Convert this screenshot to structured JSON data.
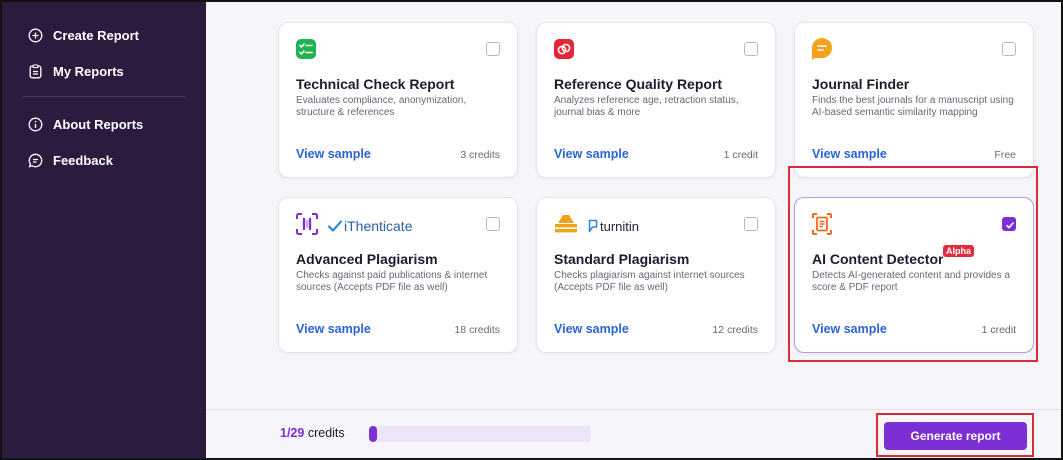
{
  "sidebar": {
    "items": [
      {
        "label": "Create Report",
        "icon": "plus-circle-icon"
      },
      {
        "label": "My Reports",
        "icon": "clipboard-icon"
      },
      {
        "label": "About Reports",
        "icon": "info-circle-icon"
      },
      {
        "label": "Feedback",
        "icon": "message-square-icon"
      }
    ]
  },
  "cards": [
    {
      "title": "Technical Check Report",
      "desc": "Evaluates compliance, anonymization, structure & references",
      "sample": "View sample",
      "credits": "3 credits",
      "checked": false,
      "icon": "checklist-icon",
      "icon_color": "#1eb253"
    },
    {
      "title": "Reference Quality Report",
      "desc": "Analyzes reference age, retraction status, journal bias & more",
      "sample": "View sample",
      "credits": "1 credit",
      "checked": false,
      "icon": "link-icon",
      "icon_color": "#e5253a"
    },
    {
      "title": "Journal Finder",
      "desc": "Finds the best journals for a manuscript using AI-based semantic similarity mapping",
      "sample": "View sample",
      "credits": "Free",
      "checked": false,
      "icon": "chat-bubble-icon",
      "icon_color": "#f2a31b"
    },
    {
      "title": "Advanced Plagiarism",
      "desc": "Checks against paid publications & internet sources (Accepts PDF file as well)",
      "sample": "View sample",
      "credits": "18 credits",
      "checked": false,
      "icon": "scan-icon",
      "icon_color": "#7b2fd4",
      "partner": "iThenticate"
    },
    {
      "title": "Standard Plagiarism",
      "desc": "Checks plagiarism against internet sources (Accepts PDF file as well)",
      "sample": "View sample",
      "credits": "12 credits",
      "checked": false,
      "icon": "stack-icon",
      "icon_color": "#f2a31b",
      "partner": "turnitin"
    },
    {
      "title": "AI Content Detector",
      "desc": "Detects AI-generated content and provides a score & PDF report",
      "sample": "View sample",
      "credits": "1 credit",
      "checked": true,
      "icon": "document-scan-icon",
      "icon_color": "#f0691f",
      "badge": "Alpha"
    }
  ],
  "footer": {
    "credits_used": "1/29",
    "credits_label": "credits",
    "progress": 0.034,
    "generate_label": "Generate report"
  },
  "colors": {
    "accent": "#7b2fd4",
    "sidebar": "#2b1b3f",
    "link": "#2b63d9",
    "highlight": "#d92b36"
  }
}
